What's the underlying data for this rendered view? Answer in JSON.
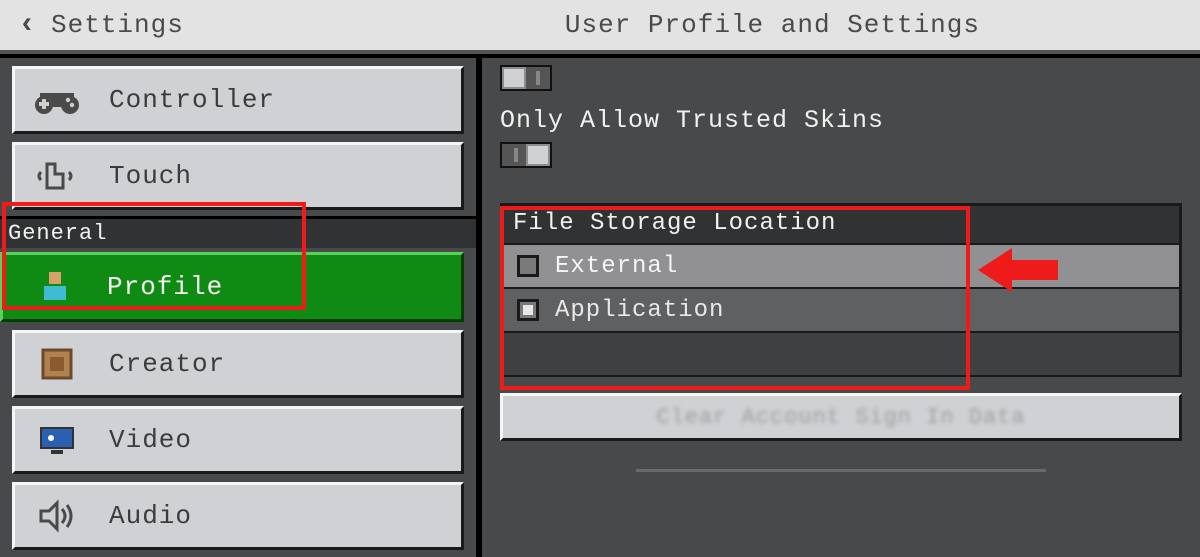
{
  "header": {
    "back_label": "Settings",
    "title": "User Profile and Settings"
  },
  "sidebar": {
    "items": [
      {
        "icon": "controller-icon",
        "label": "Controller"
      },
      {
        "icon": "touch-icon",
        "label": "Touch"
      }
    ],
    "section_label": "General",
    "general_items": [
      {
        "icon": "profile-icon",
        "label": "Profile",
        "active": true
      },
      {
        "icon": "creator-icon",
        "label": "Creator"
      },
      {
        "icon": "video-icon",
        "label": "Video"
      },
      {
        "icon": "audio-icon",
        "label": "Audio"
      }
    ]
  },
  "content": {
    "trusted_skins_label": "Only Allow Trusted Skins",
    "storage_header": "File Storage Location",
    "storage_options": [
      {
        "label": "External",
        "selected": true
      },
      {
        "label": "Application",
        "selected": false
      }
    ],
    "clear_button_label": "Clear Account Sign In Data"
  },
  "annotations": {
    "arrow_color": "#ef1a1a"
  }
}
